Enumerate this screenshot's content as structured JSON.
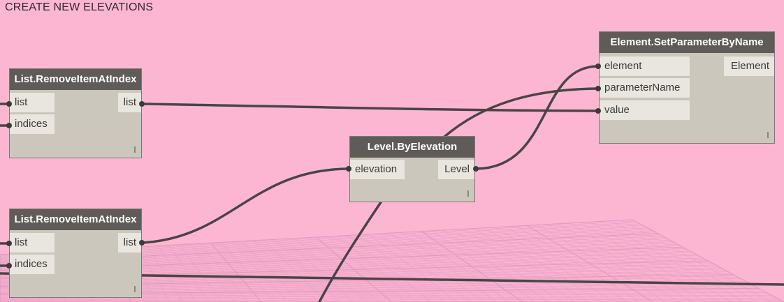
{
  "group": {
    "title": "CREATE NEW ELEVATIONS"
  },
  "nodes": {
    "remove1": {
      "title": "List.RemoveItemAtIndex",
      "inputs": [
        "list",
        "indices"
      ],
      "output": "list"
    },
    "remove2": {
      "title": "List.RemoveItemAtIndex",
      "inputs": [
        "list",
        "indices"
      ],
      "output": "list"
    },
    "level": {
      "title": "Level.ByElevation",
      "inputs": [
        "elevation"
      ],
      "output": "Level"
    },
    "setparam": {
      "title": "Element.SetParameterByName",
      "inputs": [
        "element",
        "parameterName",
        "value"
      ],
      "output": "Element"
    }
  },
  "colors": {
    "canvas": "#fdb6d2",
    "node_header": "#5e5b58",
    "node_body": "#cbc7bd",
    "port": "#e9e6df",
    "wire": "#4a4545",
    "grid": "#e29bc0"
  }
}
